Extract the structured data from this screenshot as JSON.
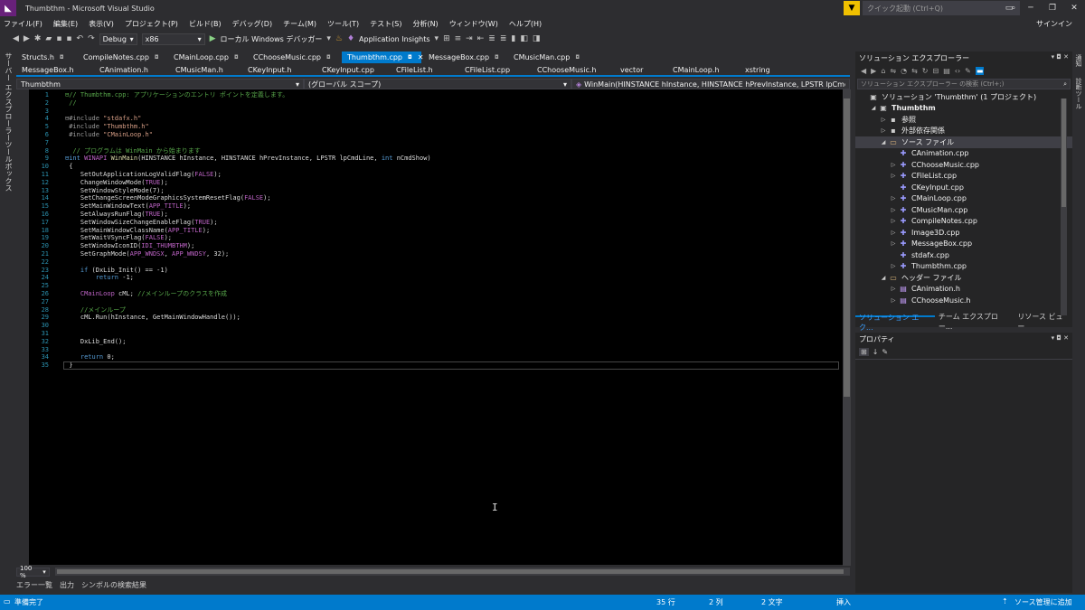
{
  "window": {
    "title": "Thumbthm - Microsoft Visual Studio",
    "logo": "vs-logo-icon"
  },
  "quick_launch": {
    "placeholder": "クイック起動 (Ctrl+Q)",
    "signin": "サインイン"
  },
  "window_controls": [
    "▭",
    "─",
    "❐",
    "✕"
  ],
  "menu": [
    "ファイル(F)",
    "編集(E)",
    "表示(V)",
    "プロジェクト(P)",
    "ビルド(B)",
    "デバッグ(D)",
    "チーム(M)",
    "ツール(T)",
    "テスト(S)",
    "分析(N)",
    "ウィンドウ(W)",
    "ヘルプ(H)"
  ],
  "toolbar": {
    "config": "Debug",
    "platform": "x86",
    "debugger": "ローカル Windows デバッガー",
    "insights": "Application Insights"
  },
  "left_tabs": [
    "サーバー エクスプローラー",
    "ツールボックス"
  ],
  "right_tabs": [
    "通知",
    "診断ツール"
  ],
  "tabs_row1": [
    {
      "label": "Structs.h",
      "active": false
    },
    {
      "label": "CompileNotes.cpp",
      "active": false
    },
    {
      "label": "CMainLoop.cpp",
      "active": false
    },
    {
      "label": "CChooseMusic.cpp",
      "active": false
    },
    {
      "label": "Thumbthm.cpp",
      "active": true
    },
    {
      "label": "MessageBox.cpp",
      "active": false
    },
    {
      "label": "CMusicMan.cpp",
      "active": false
    }
  ],
  "tabs_row2": [
    "MessageBox.h",
    "CAnimation.h",
    "CMusicMan.h",
    "CKeyInput.h",
    "CKeyInput.cpp",
    "CFileList.h",
    "CFileList.cpp",
    "CChooseMusic.h",
    "vector",
    "CMainLoop.h",
    "xstring"
  ],
  "navbar": {
    "project": "Thumbthm",
    "scope": "(グローバル スコープ)",
    "member": "WinMain(HINSTANCE hInstance, HINSTANCE hPrevInstance, LPSTR lpCmdLir"
  },
  "code_lines": [
    {
      "n": "1",
      "parts": [
        [
          "c-com",
          "⊟// Thumbthm.cpp: アプリケーションのエントリ ポイントを定義します。"
        ]
      ]
    },
    {
      "n": "2",
      "parts": [
        [
          "c-com",
          " //"
        ]
      ]
    },
    {
      "n": "3",
      "parts": [
        [
          "c-txt",
          ""
        ]
      ]
    },
    {
      "n": "4",
      "parts": [
        [
          "c-pp",
          "⊟#include "
        ],
        [
          "c-str",
          "\"stdafx.h\""
        ]
      ]
    },
    {
      "n": "5",
      "parts": [
        [
          "c-pp",
          " #include "
        ],
        [
          "c-str",
          "\"Thumbthm.h\""
        ]
      ]
    },
    {
      "n": "6",
      "parts": [
        [
          "c-pp",
          " #include "
        ],
        [
          "c-str",
          "\"CMainLoop.h\""
        ]
      ]
    },
    {
      "n": "7",
      "parts": [
        [
          "c-txt",
          ""
        ]
      ]
    },
    {
      "n": "8",
      "parts": [
        [
          "c-com",
          "  // プログラムは WinMain から始まります"
        ]
      ]
    },
    {
      "n": "9",
      "parts": [
        [
          "c-kw",
          "⊟int "
        ],
        [
          "c-mac",
          "WINAPI "
        ],
        [
          "c-fn",
          "WinMain"
        ],
        [
          "c-txt",
          "(HINSTANCE hInstance, HINSTANCE hPrevInstance, LPSTR lpCmdLine, "
        ],
        [
          "c-kw",
          "int"
        ],
        [
          "c-txt",
          " nCmdShow)"
        ]
      ]
    },
    {
      "n": "10",
      "parts": [
        [
          "c-txt",
          " {"
        ]
      ]
    },
    {
      "n": "11",
      "parts": [
        [
          "c-txt",
          "    SetOutApplicationLogValidFlag("
        ],
        [
          "c-mac",
          "FALSE"
        ],
        [
          "c-txt",
          ");"
        ]
      ]
    },
    {
      "n": "12",
      "parts": [
        [
          "c-txt",
          "    ChangeWindowMode("
        ],
        [
          "c-mac",
          "TRUE"
        ],
        [
          "c-txt",
          ");"
        ]
      ]
    },
    {
      "n": "13",
      "parts": [
        [
          "c-txt",
          "    SetWindowStyleMode(7);"
        ]
      ]
    },
    {
      "n": "14",
      "parts": [
        [
          "c-txt",
          "    SetChangeScreenModeGraphicsSystemResetFlag("
        ],
        [
          "c-mac",
          "FALSE"
        ],
        [
          "c-txt",
          ");"
        ]
      ]
    },
    {
      "n": "15",
      "parts": [
        [
          "c-txt",
          "    SetMainWindowText("
        ],
        [
          "c-mac",
          "APP_TITLE"
        ],
        [
          "c-txt",
          ");"
        ]
      ]
    },
    {
      "n": "16",
      "parts": [
        [
          "c-txt",
          "    SetAlwaysRunFlag("
        ],
        [
          "c-mac",
          "TRUE"
        ],
        [
          "c-txt",
          ");"
        ]
      ]
    },
    {
      "n": "17",
      "parts": [
        [
          "c-txt",
          "    SetWindowSizeChangeEnableFlag("
        ],
        [
          "c-mac",
          "TRUE"
        ],
        [
          "c-txt",
          ");"
        ]
      ]
    },
    {
      "n": "18",
      "parts": [
        [
          "c-txt",
          "    SetMainWindowClassName("
        ],
        [
          "c-mac",
          "APP_TITLE"
        ],
        [
          "c-txt",
          ");"
        ]
      ]
    },
    {
      "n": "19",
      "parts": [
        [
          "c-txt",
          "    SetWaitVSyncFlag("
        ],
        [
          "c-mac",
          "FALSE"
        ],
        [
          "c-txt",
          ");"
        ]
      ]
    },
    {
      "n": "20",
      "parts": [
        [
          "c-txt",
          "    SetWindowIconID("
        ],
        [
          "c-mac",
          "IDI_THUMBTHM"
        ],
        [
          "c-txt",
          ");"
        ]
      ]
    },
    {
      "n": "21",
      "parts": [
        [
          "c-txt",
          "    SetGraphMode("
        ],
        [
          "c-mac",
          "APP_WNDSX"
        ],
        [
          "c-txt",
          ", "
        ],
        [
          "c-mac",
          "APP_WNDSY"
        ],
        [
          "c-txt",
          ", 32);"
        ]
      ]
    },
    {
      "n": "22",
      "parts": [
        [
          "c-txt",
          ""
        ]
      ]
    },
    {
      "n": "23",
      "parts": [
        [
          "c-kw",
          "    if"
        ],
        [
          "c-txt",
          " (DxLib_Init() == -1)"
        ]
      ]
    },
    {
      "n": "24",
      "parts": [
        [
          "c-kw",
          "        return"
        ],
        [
          "c-txt",
          " -1;"
        ]
      ]
    },
    {
      "n": "25",
      "parts": [
        [
          "c-txt",
          ""
        ]
      ]
    },
    {
      "n": "26",
      "parts": [
        [
          "c-mac",
          "    CMainLoop"
        ],
        [
          "c-txt",
          " cML; "
        ],
        [
          "c-com",
          "//メインループのクラスを作成"
        ]
      ]
    },
    {
      "n": "27",
      "parts": [
        [
          "c-txt",
          ""
        ]
      ]
    },
    {
      "n": "28",
      "parts": [
        [
          "c-com",
          "    //メインループ"
        ]
      ]
    },
    {
      "n": "29",
      "parts": [
        [
          "c-txt",
          "    cML.Run(hInstance, GetMainWindowHandle());"
        ]
      ]
    },
    {
      "n": "30",
      "parts": [
        [
          "c-txt",
          ""
        ]
      ]
    },
    {
      "n": "31",
      "parts": [
        [
          "c-txt",
          ""
        ]
      ]
    },
    {
      "n": "32",
      "parts": [
        [
          "c-txt",
          "    DxLib_End();"
        ]
      ]
    },
    {
      "n": "33",
      "parts": [
        [
          "c-txt",
          ""
        ]
      ]
    },
    {
      "n": "34",
      "parts": [
        [
          "c-kw",
          "    return"
        ],
        [
          "c-txt",
          " 0;"
        ]
      ]
    },
    {
      "n": "35",
      "parts": [
        [
          "c-txt",
          " }"
        ]
      ]
    }
  ],
  "zoom": "100 %",
  "bottom_tabs": [
    "エラー一覧",
    "出力",
    "シンボルの検索結果"
  ],
  "status": {
    "ready": "準備完了",
    "line": "35 行",
    "col": "2 列",
    "ch": "2 文字",
    "mode": "挿入",
    "scc": "ソース管理に追加"
  },
  "solution_explorer": {
    "title": "ソリューション エクスプローラー",
    "search_placeholder": "ソリューション エクスプローラー の検索 (Ctrl+;)",
    "tree": [
      {
        "indent": 0,
        "tw": "",
        "icon": "▣",
        "label": "ソリューション 'Thumbthm' (1 プロジェクト)",
        "bold": false,
        "sel": false
      },
      {
        "indent": 1,
        "tw": "◢",
        "icon": "▣",
        "label": "Thumbthm",
        "bold": true,
        "sel": false
      },
      {
        "indent": 2,
        "tw": "▷",
        "icon": "▪",
        "label": "参照",
        "bold": false,
        "sel": false
      },
      {
        "indent": 2,
        "tw": "▷",
        "icon": "▪",
        "label": "外部依存関係",
        "bold": false,
        "sel": false
      },
      {
        "indent": 2,
        "tw": "◢",
        "icon": "▭",
        "label": "ソース ファイル",
        "bold": false,
        "sel": true
      },
      {
        "indent": 3,
        "tw": "",
        "icon": "✚",
        "label": "CAnimation.cpp",
        "bold": false,
        "sel": false
      },
      {
        "indent": 3,
        "tw": "▷",
        "icon": "✚",
        "label": "CChooseMusic.cpp",
        "bold": false,
        "sel": false
      },
      {
        "indent": 3,
        "tw": "▷",
        "icon": "✚",
        "label": "CFileList.cpp",
        "bold": false,
        "sel": false
      },
      {
        "indent": 3,
        "tw": "",
        "icon": "✚",
        "label": "CKeyInput.cpp",
        "bold": false,
        "sel": false
      },
      {
        "indent": 3,
        "tw": "▷",
        "icon": "✚",
        "label": "CMainLoop.cpp",
        "bold": false,
        "sel": false
      },
      {
        "indent": 3,
        "tw": "▷",
        "icon": "✚",
        "label": "CMusicMan.cpp",
        "bold": false,
        "sel": false
      },
      {
        "indent": 3,
        "tw": "▷",
        "icon": "✚",
        "label": "CompileNotes.cpp",
        "bold": false,
        "sel": false
      },
      {
        "indent": 3,
        "tw": "▷",
        "icon": "✚",
        "label": "Image3D.cpp",
        "bold": false,
        "sel": false
      },
      {
        "indent": 3,
        "tw": "▷",
        "icon": "✚",
        "label": "MessageBox.cpp",
        "bold": false,
        "sel": false
      },
      {
        "indent": 3,
        "tw": "",
        "icon": "✚",
        "label": "stdafx.cpp",
        "bold": false,
        "sel": false
      },
      {
        "indent": 3,
        "tw": "▷",
        "icon": "✚",
        "label": "Thumbthm.cpp",
        "bold": false,
        "sel": false
      },
      {
        "indent": 2,
        "tw": "◢",
        "icon": "▭",
        "label": "ヘッダー ファイル",
        "bold": false,
        "sel": false
      },
      {
        "indent": 3,
        "tw": "▷",
        "icon": "▤",
        "label": "CAnimation.h",
        "bold": false,
        "sel": false
      },
      {
        "indent": 3,
        "tw": "▷",
        "icon": "▤",
        "label": "CChooseMusic.h",
        "bold": false,
        "sel": false
      }
    ],
    "bottom_tabs": [
      {
        "label": "ソリューション エク...",
        "active": true
      },
      {
        "label": "チーム エクスプロー...",
        "active": false
      },
      {
        "label": "リソース ビュー",
        "active": false
      }
    ]
  },
  "properties": {
    "title": "プロパティ"
  }
}
